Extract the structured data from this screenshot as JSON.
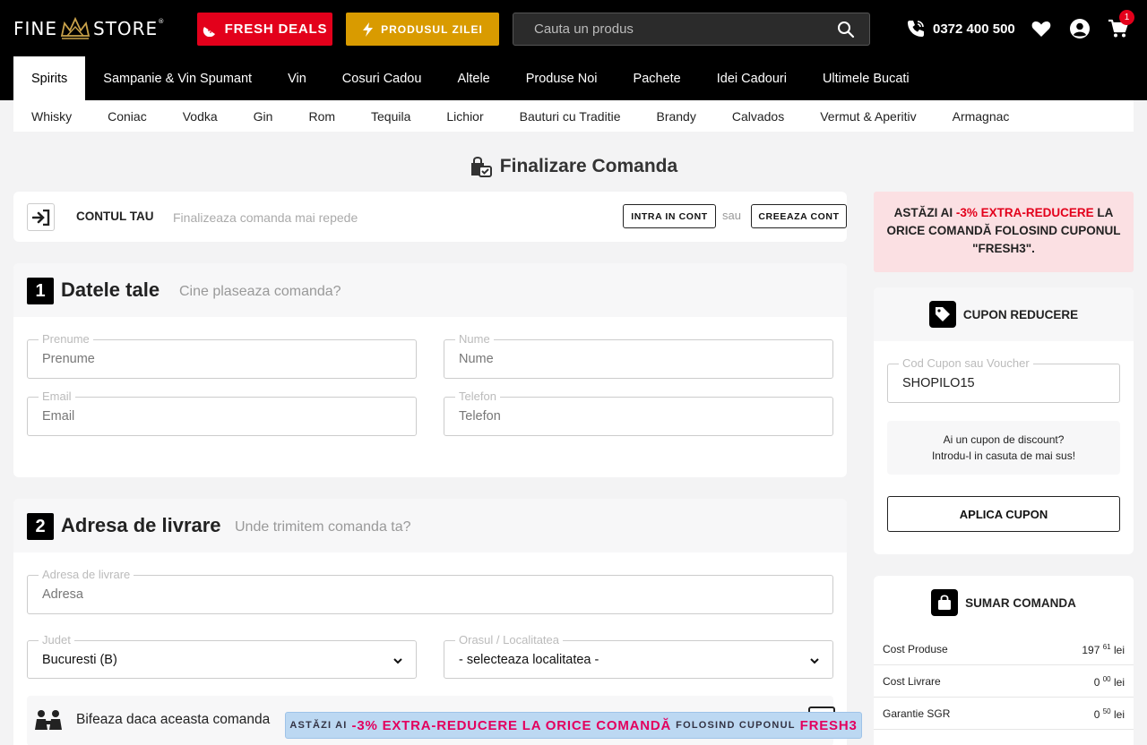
{
  "header": {
    "logo_left": "FINE",
    "logo_right": "STORE",
    "logo_mark": "®",
    "fresh_deals": "FRESH DEALS",
    "produsul_zilei": "PRODUSUL ZILEI",
    "search_placeholder": "Cauta un produs",
    "phone": "0372 400 500",
    "cart_count": "1"
  },
  "main_nav": [
    "Spirits",
    "Sampanie & Vin Spumant",
    "Vin",
    "Cosuri Cadou",
    "Altele",
    "Produse Noi",
    "Pachete",
    "Idei Cadouri",
    "Ultimele Bucati"
  ],
  "sub_nav": [
    "Whisky",
    "Coniac",
    "Vodka",
    "Gin",
    "Rom",
    "Tequila",
    "Lichior",
    "Bauturi cu Traditie",
    "Brandy",
    "Calvados",
    "Vermut & Aperitiv",
    "Armagnac"
  ],
  "page_title": "Finalizare Comanda",
  "account": {
    "label": "CONTUL TAU",
    "hint": "Finalizeaza comanda mai repede",
    "login": "INTRA IN CONT",
    "or": "sau",
    "create": "CREEAZA CONT"
  },
  "section1": {
    "num": "1",
    "title": "Datele tale",
    "sub": "Cine plaseaza comanda?",
    "first_name_label": "Prenume",
    "first_name_placeholder": "Prenume",
    "last_name_label": "Nume",
    "last_name_placeholder": "Nume",
    "email_label": "Email",
    "email_placeholder": "Email",
    "phone_label": "Telefon",
    "phone_placeholder": "Telefon"
  },
  "section2": {
    "num": "2",
    "title": "Adresa de livrare",
    "sub": "Unde trimitem comanda ta?",
    "address_label": "Adresa de livrare",
    "address_placeholder": "Adresa",
    "county_label": "Judet",
    "county_value": "Bucuresti (B)",
    "city_label": "Orasul / Localitatea",
    "city_value": "- selecteaza localitatea -",
    "checkbox_text": "Bifeaza daca aceasta comanda"
  },
  "promo": {
    "line_a": "ASTĂZI AI ",
    "line_red": "-3% EXTRA-REDUCERE",
    "line_b": " LA ORICE COMANDĂ FOLOSIND CUPONUL \"FRESH3\"."
  },
  "coupon": {
    "title": "CUPON REDUCERE",
    "field_label": "Cod Cupon sau Voucher",
    "field_value": "SHOPILO15",
    "info_1": "Ai un cupon de discount?",
    "info_2": "Introdu-l in casuta de mai sus!",
    "apply": "APLICA CUPON"
  },
  "summary": {
    "title": "SUMAR COMANDA",
    "rows": [
      {
        "label": "Cost Produse",
        "int": "197",
        "dec": "61",
        "cur": "lei"
      },
      {
        "label": "Cost Livrare",
        "int": "0",
        "dec": "00",
        "cur": "lei"
      },
      {
        "label": "Garantie SGR",
        "int": "0",
        "dec": "50",
        "cur": "lei"
      }
    ]
  },
  "banner": {
    "p1": "ASTĂZI AI",
    "p2": "-3% EXTRA-REDUCERE LA ORICE COMANDĂ",
    "p3": "FOLOSIND CUPONUL",
    "p4": "FRESH3"
  }
}
